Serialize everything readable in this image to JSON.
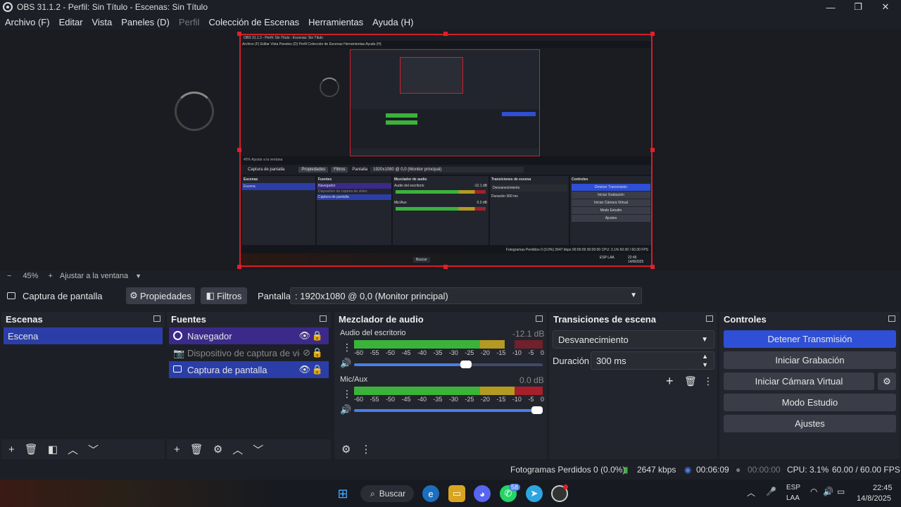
{
  "window": {
    "title": "OBS 31.1.2 - Perfil: Sin Título - Escenas: Sin Título",
    "minimize": "—",
    "maximize": "❐",
    "close": "✕"
  },
  "menu": {
    "items": [
      "Archivo (F)",
      "Editar",
      "Vista",
      "Paneles (D)",
      "Perfil",
      "Colección de Escenas",
      "Herramientas",
      "Ayuda (H)"
    ]
  },
  "zoom": {
    "minus": "−",
    "level": "45%",
    "plus": "+",
    "fit_label": "Ajustar a la ventana"
  },
  "source_bar": {
    "source_name": "Captura de pantalla",
    "properties_label": "Propiedades",
    "filters_label": "Filtros",
    "display_label": "Pantalla",
    "display_value": ": 1920x1080 @ 0,0 (Monitor principal)"
  },
  "scenes": {
    "title": "Escenas",
    "items": [
      "Escena"
    ]
  },
  "sources": {
    "title": "Fuentes",
    "items": [
      {
        "label": "Navegador",
        "state": "visible"
      },
      {
        "label": "Dispositivo de captura de video",
        "state": "hidden"
      },
      {
        "label": "Captura de pantalla",
        "state": "visible"
      }
    ]
  },
  "mixer": {
    "title": "Mezclador de audio",
    "channels": [
      {
        "name": "Audio del escritorio",
        "db": "-12.1 dB",
        "level_db": -12.1,
        "volume": 0.6
      },
      {
        "name": "Mic/Aux",
        "db": "0.0 dB",
        "level_db": 0.0,
        "volume": 1.0
      }
    ],
    "ticks": [
      "-60",
      "-55",
      "-50",
      "-45",
      "-40",
      "-35",
      "-30",
      "-25",
      "-20",
      "-15",
      "-10",
      "-5",
      "0"
    ]
  },
  "transitions": {
    "title": "Transiciones de escena",
    "selected": "Desvanecimiento",
    "duration_label": "Duración",
    "duration_value": "300 ms"
  },
  "controls": {
    "title": "Controles",
    "stop_stream": "Detener Transmisión",
    "start_recording": "Iniciar Grabación",
    "start_virtual_cam": "Iniciar Cámara Virtual",
    "studio_mode": "Modo Estudio",
    "settings": "Ajustes"
  },
  "status": {
    "dropped": "Fotogramas Perdidos 0 (0.0%)",
    "bitrate": "2647 kbps",
    "stream_time": "00:06:09",
    "rec_time": "00:00:00",
    "cpu": "CPU: 3.1%",
    "fps": "60.00 / 60.00 FPS"
  },
  "taskbar": {
    "search": "Buscar",
    "whatsapp_badge": "58",
    "lang_top": "ESP",
    "lang_bottom": "LAA",
    "time": "22:45",
    "date": "14/8/2025"
  },
  "captured_preview": {
    "title": "OBS 31.1.2 - Perfil: Sin Título - Escenas: Sin Título",
    "menu": "Archivo (F)   Editar   Vista   Paneles (D)   Perfil   Colección de Escenas   Herramientas   Ayuda (H)",
    "zoom": "45%   Ajustar a la ventana",
    "source_name": "Captura de pantalla",
    "properties": "Propiedades",
    "filters": "Filtros",
    "display_label": "Pantalla",
    "display_value": "1920x1080 @ 0,0 (Monitor principal)",
    "scenes_title": "Escenas",
    "scene": "Escena",
    "sources_title": "Fuentes",
    "src1": "Navegador",
    "src2": "Dispositivo de captura de video",
    "src3": "Captura de pantalla",
    "mixer_title": "Mezclador de audio",
    "ch1": "Audio del escritorio",
    "ch1_db": "-12.1 dB",
    "ch2": "Mic/Aux",
    "ch2_db": "0.0 dB",
    "trans_title": "Transiciones de escena",
    "trans": "Desvanecimiento",
    "dur_label": "Duración",
    "dur": "300 ms",
    "ctrl_title": "Controles",
    "c1": "Detener Transmisión",
    "c2": "Iniciar Grabación",
    "c3": "Iniciar Cámara Virtual",
    "c4": "Modo Estudio",
    "c5": "Ajustes",
    "status": "Fotogramas Perdidos 0 (0.0%)   2647 kbps   00:06:09   00:00:00   CPU: 3.1%   60.00 / 60.00 FPS",
    "search": "Buscar",
    "lang": "ESP LAA",
    "clock": "22:45 14/8/2025"
  },
  "colors": {
    "accent": "#2b3ea8",
    "stop_button": "#2f4fd6",
    "recording_border": "#d0202a"
  }
}
